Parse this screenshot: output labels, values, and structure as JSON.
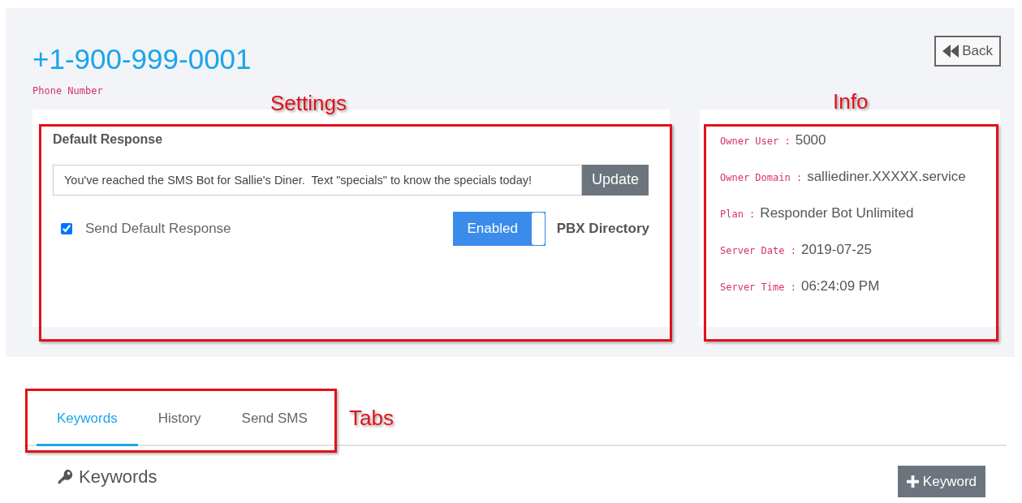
{
  "page": {
    "title": "+1-900-999-0001",
    "subtitle": "Phone Number"
  },
  "back_button": {
    "label": "Back"
  },
  "settings": {
    "heading": "Default Response",
    "response": "You've reached the SMS Bot for Sallie's Diner.  Text \"specials\" to know the specials today!",
    "update_button": "Update",
    "send_default": {
      "label": "Send Default Response",
      "checked": true
    },
    "toggle": {
      "label": "Enabled",
      "on": true
    },
    "toggle_caption": "PBX Directory"
  },
  "info": [
    {
      "key": "Owner User :",
      "value": "5000"
    },
    {
      "key": "Owner Domain :",
      "value": "salliediner.XXXXX.service"
    },
    {
      "key": "Plan :",
      "value": "Responder Bot Unlimited"
    },
    {
      "key": "Server Date :",
      "value": "2019-07-25"
    },
    {
      "key": "Server Time :",
      "value": "06:24:09 PM"
    }
  ],
  "tabs": [
    {
      "label": "Keywords",
      "selected": true
    },
    {
      "label": "History",
      "selected": false
    },
    {
      "label": "Send SMS",
      "selected": false
    }
  ],
  "keywords_panel": {
    "heading": "Keywords",
    "add_button": "Keyword"
  },
  "annotations": [
    {
      "label": "Settings"
    },
    {
      "label": "Info"
    },
    {
      "label": "Tabs"
    }
  ]
}
